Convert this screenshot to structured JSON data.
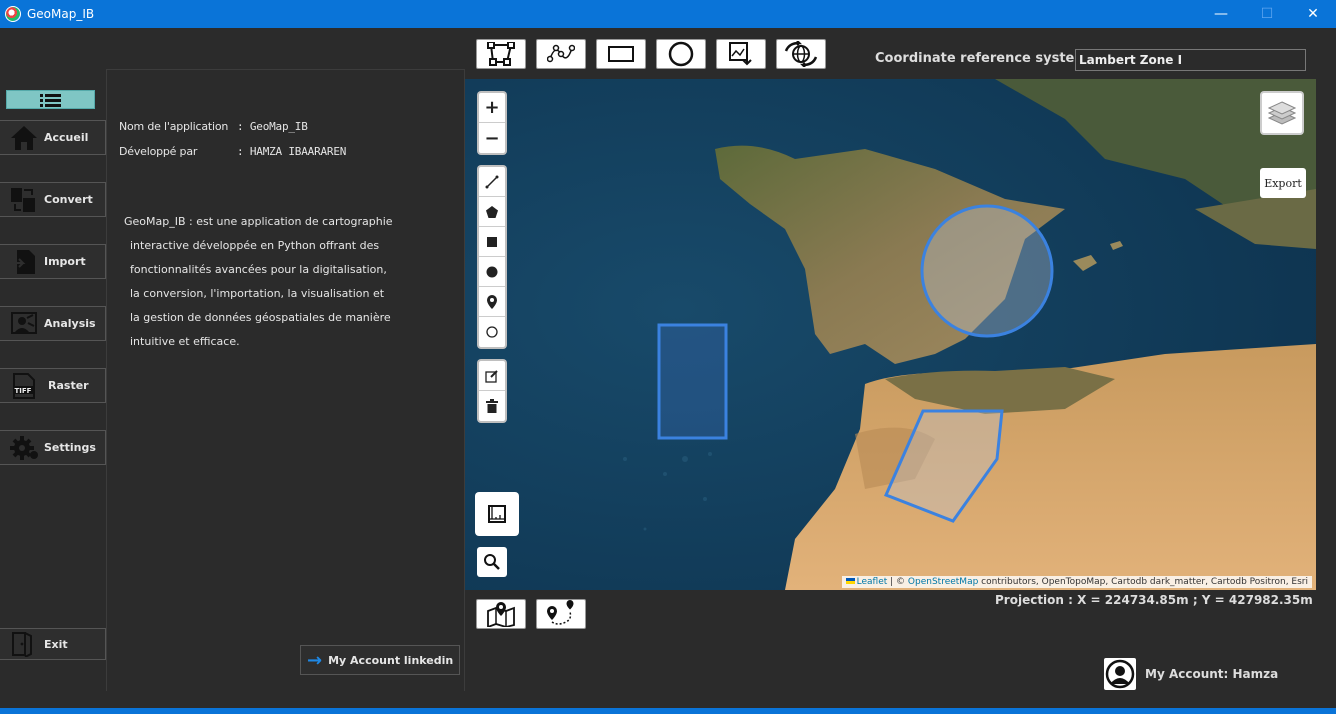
{
  "window": {
    "title": "GeoMap_IB",
    "controls": {
      "minimize": "—",
      "maximize": "☐",
      "close": "✕"
    }
  },
  "nav": {
    "items": [
      {
        "label": "Accueil",
        "icon": "home-icon"
      },
      {
        "label": "Convert",
        "icon": "convert-icon"
      },
      {
        "label": "Import",
        "icon": "import-icon"
      },
      {
        "label": "Analysis",
        "icon": "analysis-icon"
      },
      {
        "label": "Raster",
        "icon": "tiff-icon"
      },
      {
        "label": "Settings",
        "icon": "gear-icon"
      }
    ],
    "exit_label": "Exit"
  },
  "info": {
    "app_key": "Nom de l'application",
    "app_val": ": GeoMap_IB",
    "dev_key": "Développé par",
    "dev_val": ": HAMZA IBAARAREN",
    "desc_lines": [
      "GeoMap_IB : est une application de cartographie",
      "interactive développée en Python offrant des",
      "fonctionnalités avancées pour la digitalisation,",
      "la conversion, l'importation, la visualisation et",
      "la gestion de données géospatiales de manière",
      "intuitive et efficace."
    ],
    "linkedin_label": "My Account  linkedin"
  },
  "toolbar": {
    "tools": [
      "polygon-digitize-icon",
      "polyline-digitize-icon",
      "rectangle-icon",
      "circle-icon",
      "raster-export-icon",
      "reproject-globe-icon"
    ]
  },
  "crs": {
    "label": "Coordinate reference system :",
    "value": "Lambert Zone I"
  },
  "map": {
    "zoom_in": "+",
    "zoom_out": "−",
    "export_label": "Export",
    "attribution": {
      "leaflet": "Leaflet",
      "sep": " | © ",
      "osm": "OpenStreetMap",
      "rest": " contributors, OpenTopoMap, Cartodb dark_matter, Cartodb Positron, Esri"
    }
  },
  "projection": {
    "text": "Projection : X = 224734.85m ; Y = 427982.35m"
  },
  "account": {
    "label": "My Account: Hamza"
  }
}
